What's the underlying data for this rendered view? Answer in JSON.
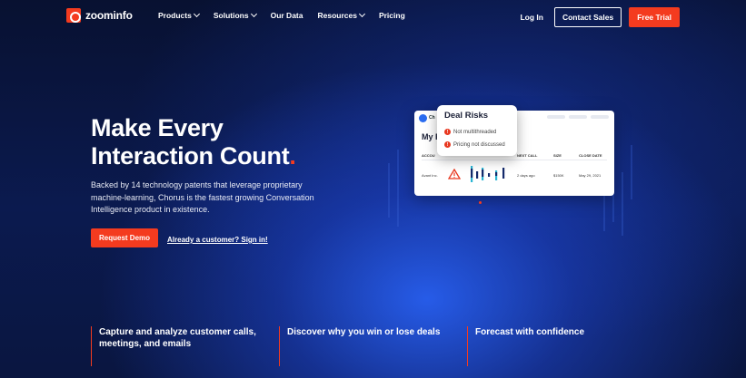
{
  "nav": {
    "logo_text": "zoominfo",
    "menu": [
      {
        "label": "Products",
        "has_dropdown": true
      },
      {
        "label": "Solutions",
        "has_dropdown": true
      },
      {
        "label": "Our Data",
        "has_dropdown": false
      },
      {
        "label": "Resources",
        "has_dropdown": true
      },
      {
        "label": "Pricing",
        "has_dropdown": false
      }
    ],
    "login": "Log In",
    "contact_sales": "Contact Sales",
    "free_trial": "Free Trial"
  },
  "hero": {
    "title_line1": "Make Every",
    "title_line2": "Interaction Count",
    "title_dot": ".",
    "subtitle": "Backed by 14 technology patents that leverage proprietary machine-learning, Chorus is the fastest growing Conversation Intelligence product in existence.",
    "cta_primary": "Request Demo",
    "cta_secondary": "Already a customer? Sign in!"
  },
  "card": {
    "brand": "Ch",
    "heading": "My F",
    "columns": [
      "ACCOU",
      "NEXT CALL",
      "SIZE",
      "CLOSE DATE"
    ],
    "row": {
      "account": "Avant Inc.",
      "next_call": "2 days ago",
      "size": "$150K",
      "close_date": "May 29, 2021"
    }
  },
  "popup": {
    "title": "Deal Risks",
    "risks": [
      "Not multithreaded",
      "Pricing not discussed"
    ]
  },
  "features": [
    {
      "line1": "Capture and analyze customer calls,",
      "line2": "meetings, and emails"
    },
    {
      "line1": "Discover why you win or lose deals",
      "line2": ""
    },
    {
      "line1": "Forecast with confidence",
      "line2": ""
    }
  ],
  "colors": {
    "accent": "#f43b1f",
    "background": "#07102e",
    "glow": "#2a5cf0"
  }
}
